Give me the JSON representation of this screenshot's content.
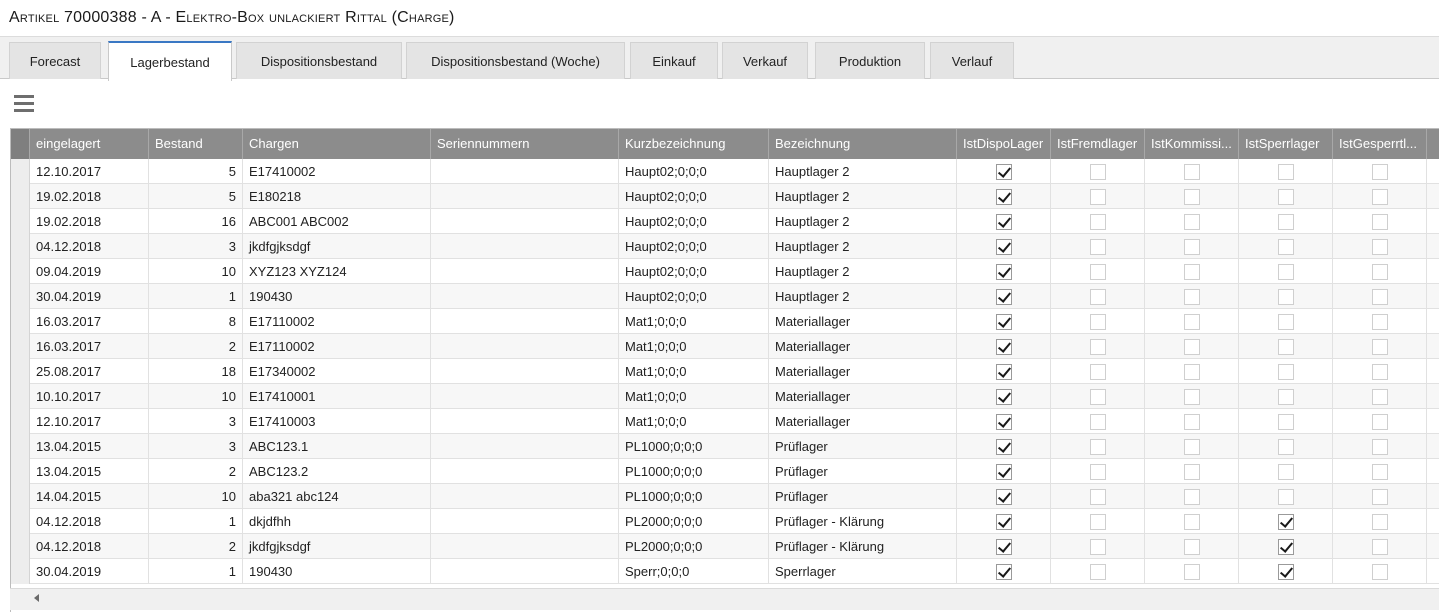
{
  "window": {
    "title": "Artikel 70000388 - A - Elektro-Box unlackiert Rittal (Charge)"
  },
  "tabs": [
    {
      "label": "Forecast",
      "active": false
    },
    {
      "label": "Lagerbestand",
      "active": true
    },
    {
      "label": "Dispositionsbestand",
      "active": false
    },
    {
      "label": "Dispositionsbestand (Woche)",
      "active": false
    },
    {
      "label": "Einkauf",
      "active": false
    },
    {
      "label": "Verkauf",
      "active": false
    },
    {
      "label": "Produktion",
      "active": false
    },
    {
      "label": "Verlauf",
      "active": false
    }
  ],
  "toolbar": {
    "menu_icon": "hamburger-menu-icon"
  },
  "grid": {
    "columns": [
      {
        "key": "eingelagert",
        "label": "eingelagert"
      },
      {
        "key": "bestand",
        "label": "Bestand"
      },
      {
        "key": "chargen",
        "label": "Chargen"
      },
      {
        "key": "seriennummern",
        "label": "Seriennummern"
      },
      {
        "key": "kurz",
        "label": "Kurzbezeichnung"
      },
      {
        "key": "bez",
        "label": "Bezeichnung"
      },
      {
        "key": "dispo",
        "label": "IstDispoLager"
      },
      {
        "key": "fremd",
        "label": "IstFremdlager"
      },
      {
        "key": "kommiss",
        "label": "IstKommissi..."
      },
      {
        "key": "sperr",
        "label": "IstSperrlager"
      },
      {
        "key": "gesperrt",
        "label": "IstGesperrtl..."
      }
    ],
    "rows": [
      {
        "eingelagert": "12.10.2017",
        "bestand": "5",
        "chargen": "E17410002",
        "seriennummern": "",
        "kurz": "Haupt02;0;0;0",
        "bez": "Hauptlager 2",
        "dispo": true,
        "fremd": false,
        "kommiss": false,
        "sperr": false,
        "gesperrt": false
      },
      {
        "eingelagert": "19.02.2018",
        "bestand": "5",
        "chargen": "E180218",
        "seriennummern": "",
        "kurz": "Haupt02;0;0;0",
        "bez": "Hauptlager 2",
        "dispo": true,
        "fremd": false,
        "kommiss": false,
        "sperr": false,
        "gesperrt": false
      },
      {
        "eingelagert": "19.02.2018",
        "bestand": "16",
        "chargen": "ABC001 ABC002",
        "seriennummern": "",
        "kurz": "Haupt02;0;0;0",
        "bez": "Hauptlager 2",
        "dispo": true,
        "fremd": false,
        "kommiss": false,
        "sperr": false,
        "gesperrt": false
      },
      {
        "eingelagert": "04.12.2018",
        "bestand": "3",
        "chargen": "jkdfgjksdgf",
        "seriennummern": "",
        "kurz": "Haupt02;0;0;0",
        "bez": "Hauptlager 2",
        "dispo": true,
        "fremd": false,
        "kommiss": false,
        "sperr": false,
        "gesperrt": false
      },
      {
        "eingelagert": "09.04.2019",
        "bestand": "10",
        "chargen": "XYZ123 XYZ124",
        "seriennummern": "",
        "kurz": "Haupt02;0;0;0",
        "bez": "Hauptlager 2",
        "dispo": true,
        "fremd": false,
        "kommiss": false,
        "sperr": false,
        "gesperrt": false
      },
      {
        "eingelagert": "30.04.2019",
        "bestand": "1",
        "chargen": "190430",
        "seriennummern": "",
        "kurz": "Haupt02;0;0;0",
        "bez": "Hauptlager 2",
        "dispo": true,
        "fremd": false,
        "kommiss": false,
        "sperr": false,
        "gesperrt": false
      },
      {
        "eingelagert": "16.03.2017",
        "bestand": "8",
        "chargen": "E17110002",
        "seriennummern": "",
        "kurz": "Mat1;0;0;0",
        "bez": "Materiallager",
        "dispo": true,
        "fremd": false,
        "kommiss": false,
        "sperr": false,
        "gesperrt": false
      },
      {
        "eingelagert": "16.03.2017",
        "bestand": "2",
        "chargen": "E17110002",
        "seriennummern": "",
        "kurz": "Mat1;0;0;0",
        "bez": "Materiallager",
        "dispo": true,
        "fremd": false,
        "kommiss": false,
        "sperr": false,
        "gesperrt": false
      },
      {
        "eingelagert": "25.08.2017",
        "bestand": "18",
        "chargen": "E17340002",
        "seriennummern": "",
        "kurz": "Mat1;0;0;0",
        "bez": "Materiallager",
        "dispo": true,
        "fremd": false,
        "kommiss": false,
        "sperr": false,
        "gesperrt": false
      },
      {
        "eingelagert": "10.10.2017",
        "bestand": "10",
        "chargen": "E17410001",
        "seriennummern": "",
        "kurz": "Mat1;0;0;0",
        "bez": "Materiallager",
        "dispo": true,
        "fremd": false,
        "kommiss": false,
        "sperr": false,
        "gesperrt": false
      },
      {
        "eingelagert": "12.10.2017",
        "bestand": "3",
        "chargen": "E17410003",
        "seriennummern": "",
        "kurz": "Mat1;0;0;0",
        "bez": "Materiallager",
        "dispo": true,
        "fremd": false,
        "kommiss": false,
        "sperr": false,
        "gesperrt": false
      },
      {
        "eingelagert": "13.04.2015",
        "bestand": "3",
        "chargen": "ABC123.1",
        "seriennummern": "",
        "kurz": "PL1000;0;0;0",
        "bez": "Prüflager",
        "dispo": true,
        "fremd": false,
        "kommiss": false,
        "sperr": false,
        "gesperrt": false
      },
      {
        "eingelagert": "13.04.2015",
        "bestand": "2",
        "chargen": "ABC123.2",
        "seriennummern": "",
        "kurz": "PL1000;0;0;0",
        "bez": "Prüflager",
        "dispo": true,
        "fremd": false,
        "kommiss": false,
        "sperr": false,
        "gesperrt": false
      },
      {
        "eingelagert": "14.04.2015",
        "bestand": "10",
        "chargen": "aba321 abc124",
        "seriennummern": "",
        "kurz": "PL1000;0;0;0",
        "bez": "Prüflager",
        "dispo": true,
        "fremd": false,
        "kommiss": false,
        "sperr": false,
        "gesperrt": false
      },
      {
        "eingelagert": "04.12.2018",
        "bestand": "1",
        "chargen": "dkjdfhh",
        "seriennummern": "",
        "kurz": "PL2000;0;0;0",
        "bez": "Prüflager - Klärung",
        "dispo": true,
        "fremd": false,
        "kommiss": false,
        "sperr": true,
        "gesperrt": false
      },
      {
        "eingelagert": "04.12.2018",
        "bestand": "2",
        "chargen": "jkdfgjksdgf",
        "seriennummern": "",
        "kurz": "PL2000;0;0;0",
        "bez": "Prüflager - Klärung",
        "dispo": true,
        "fremd": false,
        "kommiss": false,
        "sperr": true,
        "gesperrt": false
      },
      {
        "eingelagert": "30.04.2019",
        "bestand": "1",
        "chargen": "190430",
        "seriennummern": "",
        "kurz": "Sperr;0;0;0",
        "bez": "Sperrlager",
        "dispo": true,
        "fremd": false,
        "kommiss": false,
        "sperr": true,
        "gesperrt": false
      }
    ]
  },
  "colors": {
    "header_bg": "#8c8c8c",
    "active_tab_accent": "#3a78c4"
  }
}
